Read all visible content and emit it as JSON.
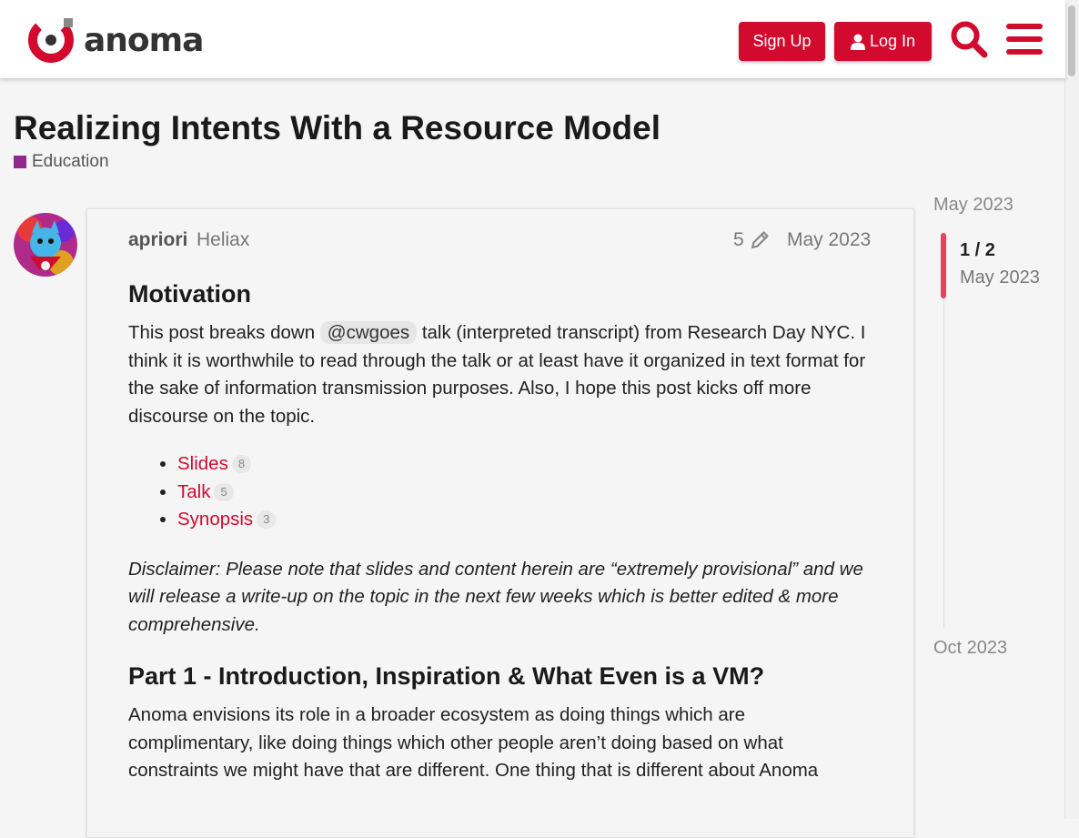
{
  "header": {
    "logo_text": "anoma",
    "signup_label": "Sign Up",
    "login_label": "Log In",
    "accent_color": "#d10a2e"
  },
  "topic": {
    "title": "Realizing Intents With a Resource Model",
    "category": "Education",
    "category_color": "#92278f"
  },
  "post": {
    "username": "apriori",
    "user_title": "Heliax",
    "edit_count": "5",
    "date": "May 2023",
    "heading1": "Motivation",
    "p1_before": "This post breaks down ",
    "mention": "@cwgoes",
    "p1_after": " talk (interpreted transcript) from Research Day NYC. I think it is worthwhile to read through the talk or at least have it organized in text format for the sake of information transmission purposes. Also, I hope this post kicks off more discourse on the topic.",
    "links": [
      {
        "label": "Slides",
        "clicks": "8"
      },
      {
        "label": "Talk",
        "clicks": "5"
      },
      {
        "label": "Synopsis",
        "clicks": "3"
      }
    ],
    "disclaimer": "Disclaimer: Please note that slides and content herein are “extremely provisional” and we will release a write-up on the topic in the next few weeks which is better edited & more comprehensive.",
    "heading2": "Part 1 - Introduction, Inspiration & What Even is a VM?",
    "p2": "Anoma envisions its role in a broader ecosystem as doing things which are complimentary, like doing things which other people aren’t doing based on what constraints we might have that are different. One thing that is different about Anoma"
  },
  "timeline": {
    "start": "May 2023",
    "position": "1 / 2",
    "current_date": "May 2023",
    "end": "Oct 2023"
  }
}
